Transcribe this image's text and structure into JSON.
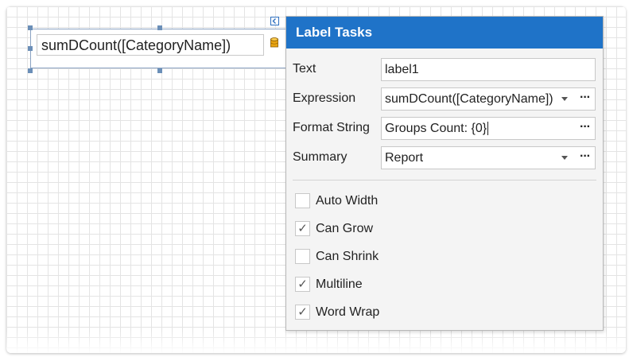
{
  "designer": {
    "label_text": "sumDCount([CategoryName])"
  },
  "panel": {
    "title": "Label Tasks",
    "rows": [
      {
        "label": "Text",
        "value": "label1"
      },
      {
        "label": "Expression",
        "value": "sumDCount([CategoryName])"
      },
      {
        "label": "Format String",
        "value": "Groups Count: {0}"
      },
      {
        "label": "Summary",
        "value": "Report"
      }
    ],
    "ellipsis": "···",
    "checkboxes": [
      {
        "label": "Auto Width",
        "checked": false
      },
      {
        "label": "Can Grow",
        "checked": true
      },
      {
        "label": "Can Shrink",
        "checked": false
      },
      {
        "label": "Multiline",
        "checked": true
      },
      {
        "label": "Word Wrap",
        "checked": true
      }
    ],
    "check_glyph": "✓"
  },
  "icons": [
    "smart-tag-icon",
    "database-icon",
    "dropdown-arrow-icon",
    "ellipsis-icon",
    "checkmark-icon"
  ],
  "colors": {
    "header": "#1f73c8",
    "handle": "#6b8fb8",
    "panel_bg": "#f4f4f4"
  }
}
